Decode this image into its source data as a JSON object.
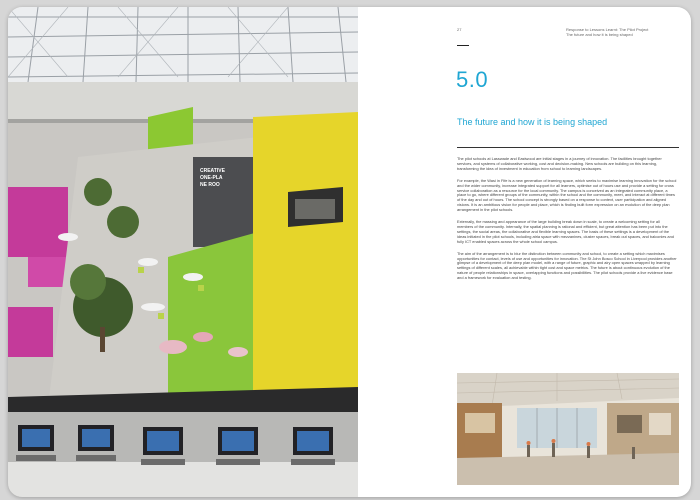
{
  "page": {
    "number": "27",
    "running_head": [
      "Response to Lessons Learnt: The Pilot Project",
      "The future and how it is being shaped"
    ],
    "section_number": "5.0",
    "section_title": "The future and how it is being shaped",
    "paragraphs": [
      "The pilot schools at Lasswade and Eastwood are initial stages in a journey of innovation. The facilities brought together services, and systems of collaborative working, cost and decision-making. New schools are building on this learning, transforming the idea of investment in education from school to learning landscapes.",
      "For example, the Wasi in Fife is a new generation of learning space, which seeks to maximise learning innovation for the school and the wider community, increase integrated support for all learners, optimise out of hours use and provide a setting for cross service collaboration as a resource for the local community. The campus is conceived as an integrated community place, a place to go, where different groups of the community, within the school and the community, meet, and interact at different times of the day and out of hours. The school concept is strongly based on a response to context, user participation and aligned visions. It is an ambitious vision for people and place, which is finding built form expression on an evolution of the deep plan arrangement in the pilot schools.",
      "Externally, the massing and appearance of the large building break down in scale, to create a welcoming setting for all members of the community. Internally, the spatial planning is rational and efficient, but great attention has been put into the settings, the social areas, the collaborative and flexible learning spaces. The basis of these settings is a development of the ideas initiated in the pilot schools, including atria space with mezzanines, cluster spaces, break out spaces, and balconies and fully ICT enabled spaces across the whole school campus.",
      "The aim of the arrangement is to blur the distinction between community and school, to create a setting which maximises opportunities for contact, levels of use and opportunities for innovation. The St John Bosco School in Liverpool provides another glimpse of a development of the deep plan model, with a range of future, graphic and airy open spaces wrapped by learning settings of different scales, all achievable within tight cost and space metrics. The future is about continuous evolution of the nature of people relationships in space, overlapping functions and possibilities. The pilot schools provide a live evidence base and a framework for evaluation and testing."
    ]
  },
  "photo": {
    "sign_lines": [
      "CREATIVE",
      "ONE-PLA",
      "NE ROO"
    ]
  },
  "colors": {
    "accent": "#1fa6d3",
    "yellow_wall": "#e6d52a",
    "green_wall": "#8cc832",
    "magenta": "#c43a9a"
  }
}
